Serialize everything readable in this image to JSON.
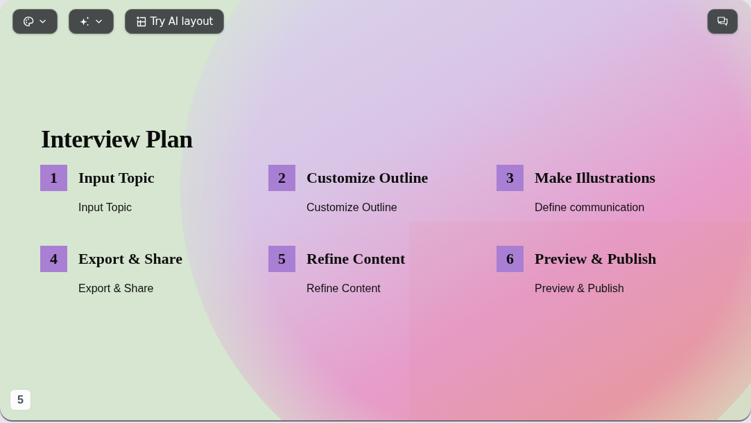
{
  "toolbar_left": [
    {
      "kind": "palette"
    },
    {
      "kind": "sparkle"
    },
    {
      "kind": "layout",
      "label": "Try AI layout"
    }
  ],
  "toolbar_right": [
    {
      "kind": "chat"
    }
  ],
  "slide": {
    "title": "Interview Plan",
    "steps": [
      {
        "number": "1",
        "heading": "Input Topic",
        "text": "Input Topic"
      },
      {
        "number": "2",
        "heading": "Customize Outline",
        "text": "Customize Outline"
      },
      {
        "number": "3",
        "heading": "Make Illustrations",
        "text": "Define communication"
      },
      {
        "number": "4",
        "heading": "Export & Share",
        "text": "Export & Share"
      },
      {
        "number": "5",
        "heading": "Refine Content",
        "text": "Refine Content"
      },
      {
        "number": "6",
        "heading": "Preview & Publish",
        "text": "Preview & Publish"
      }
    ]
  },
  "page_number": "5"
}
